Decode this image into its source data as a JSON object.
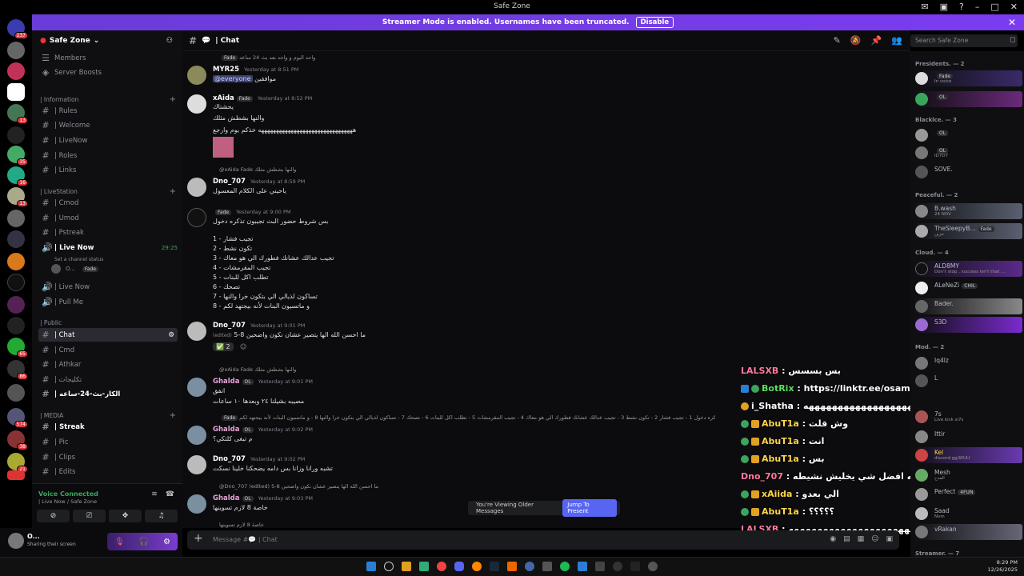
{
  "window": {
    "title": "Safe Zone"
  },
  "banner": {
    "text": "Streamer Mode is enabled. Usernames have been truncated.",
    "button": "Disable"
  },
  "server": {
    "name": "Safe Zone"
  },
  "sidebar": {
    "top_items": [
      "Members",
      "Server Boosts"
    ],
    "categories": [
      {
        "label": "| Information",
        "channels": [
          "| Rules",
          "| Welcome",
          "| LiveNow",
          "| Roles",
          "| Links"
        ]
      },
      {
        "label": "| LiveStation",
        "channels": [
          "| Cmod",
          "| Umod",
          "| Pstreak",
          "| Live Now",
          "| Live Now",
          "| Pull Me"
        ]
      },
      {
        "label": "| Public",
        "channels": [
          "| Chat",
          "| Cmd",
          "| Athkar",
          "| تكليجات",
          "| الكار-بث-24-ساعه"
        ]
      },
      {
        "label": "| MEDIA",
        "channels": [
          "| Streak",
          "| Pic",
          "| Clips",
          "| Edits"
        ]
      }
    ],
    "live_now_time": "29:25",
    "channel_status": "Set a channel status",
    "voice_user": "O...",
    "voice_tag": "Fade"
  },
  "voice": {
    "status": "Voice Connected",
    "location": "| Live Now / Safe Zone"
  },
  "user": {
    "name": "O...",
    "status": "Sharing their screen"
  },
  "chat": {
    "channel": "| Chat",
    "search_placeholder": "Search Safe Zone",
    "input_placeholder": "Message #💬 | Chat",
    "messages": [
      {
        "reply": "واحد اليوم و واحد بعد بث 24 ساعه",
        "tag": "Fade"
      },
      {
        "user": "MYR25",
        "time": "Yesterday at 8:51 PM",
        "mention": "@everyone",
        "text": "موافقين"
      },
      {
        "user": "xAida",
        "tag": "Fade",
        "time": "Yesterday at 8:52 PM",
        "lines": [
          "يحشتاك",
          "والنها بشطش مثلك",
          "ههههههههههههههههههههههههههههههههه خذكم يوم وارجع"
        ]
      },
      {
        "reply": "@xAida Fade والنها بشطش مثلك"
      },
      {
        "user": "Dno_707",
        "time": "Yesterday at 8:59 PM",
        "text": "ياحيني على الكلام المعسول"
      },
      {
        "tag": "Fade",
        "time": "Yesterday at 9:00 PM",
        "lines": [
          "بس شروط حضور البث تجيبون تذكره دخول",
          "1 - تجيب فشار",
          "2 - تكون نشط",
          "3 - تجيب عدالك عشانك فطورك الي هو معاك",
          "4 - تجيب المقرمشات",
          "5 - تطلب اكل للبنات",
          "6 - تصحك",
          "7 - تساكون لذيالي الي بتكون خرا والنها",
          "8 - و ماتسيون البنات لأنه بيجتهد لكم"
        ]
      },
      {
        "user": "Dno_707",
        "time": "Yesterday at 9:01 PM",
        "text": "ما احسن الله الها يتصير عشان نكون واضحين 8-5",
        "edited": "(edited)",
        "reaction": "2"
      },
      {
        "reply": "@xAida Fade والنها بشطش مثلك"
      },
      {
        "user": "Ghalda",
        "tag": "OL",
        "time": "Yesterday at 9:01 PM",
        "lines": [
          "اتفق",
          "مصيبه بشيلنا ٢٤ وبعدها ١٠ ساعات"
        ]
      },
      {
        "reply": "شروط حضور البث تجيبون تذكره دخول 1 - تجيب فشار 2 - تكون نشط 3 - تجيب عدالك عشانك فطورك الي هو معاك 4 - تجيب المقرمشات 5 - تطلب اكل للبنات 6 - تصحك 7 - تساكون لذيالي الي بتكون خرا والنها 8 - و ماتسيون البنات لأنه بيجتهد لكم",
        "tag": "Fade"
      },
      {
        "user": "Ghalda",
        "tag": "OL",
        "time": "Yesterday at 9:02 PM",
        "text": "م تبغى كلتكي؟"
      },
      {
        "user": "Dno_707",
        "time": "Yesterday at 9:02 PM",
        "text": "تشبه ورانا وزانا بس دامه يضحكنا خلينا نسكت"
      },
      {
        "reply": "@Dno_707 (edited) ما احسن الله الها يتصير عشان نكون واضحين 8-5"
      },
      {
        "user": "Ghalda",
        "tag": "OL",
        "time": "Yesterday at 9:03 PM",
        "text": "خاصة 8 لازم تسوينها"
      },
      {
        "reply": "خاصة 8 لازم تسوينها"
      }
    ],
    "jump": {
      "text": "You're Viewing Older Messages",
      "button": "Jump To Present"
    }
  },
  "overlay": [
    {
      "user": "LALSXB",
      "text": "بس بسسس"
    },
    {
      "user": "BotRix",
      "text": "https://linktr.ee/osamaaah | هنا تلقون كل حساباتي"
    },
    {
      "user": "i_Shatha",
      "text": "ههههههههههههههههههههههه"
    },
    {
      "user": "AbuT1a",
      "text": "وش قلت"
    },
    {
      "user": "AbuT1a",
      "text": "انت"
    },
    {
      "user": "AbuT1a",
      "text": "بس"
    },
    {
      "user": "Dno_707",
      "text": "الدمه الصبريه افضل شي يخليش نشيطه"
    },
    {
      "user": "xAiida",
      "text": "الي بعدو"
    },
    {
      "user": "AbuT1a",
      "text": "؟؟؟؟؟"
    },
    {
      "user": "LALSXB",
      "text": "ههههههههههههههههههههههههههههههه"
    }
  ],
  "members": {
    "groups": [
      {
        "label": "Presidents. — 2",
        "items": [
          {
            "name": "",
            "status": "In voice",
            "tag": "Fade"
          },
          {
            "name": "",
            "tag": "OL"
          }
        ]
      },
      {
        "label": "Blacklce. — 3",
        "items": [
          {
            "name": "",
            "tag": "OL"
          },
          {
            "name": "",
            "tag": "OL",
            "status": "ID7D7"
          },
          {
            "name": "SOVE."
          }
        ]
      },
      {
        "label": "Peaceful. — 2",
        "items": [
          {
            "name": "B.wash",
            "status": "24 NOV"
          },
          {
            "name": "TheSleepyB...",
            "tag": "Fade",
            "status": "حزين"
          }
        ]
      },
      {
        "label": "Cloud. — 4",
        "items": [
          {
            "name": "ALD8MY",
            "status": "Don't stop , success isn't that ..."
          },
          {
            "name": "ALeNeZi",
            "tag": "CHIL"
          },
          {
            "name": "Bader."
          },
          {
            "name": "S3D"
          }
        ]
      },
      {
        "label": "Mod. — 2",
        "items": [
          {
            "name": "Iq4lz"
          },
          {
            "name": "L"
          }
        ]
      },
      {
        "label": "",
        "items": [
          {
            "name": "7s",
            "status": "Live kick si7s"
          },
          {
            "name": "Ittir"
          },
          {
            "name": "Kel",
            "status": "discord.gg/WUU"
          },
          {
            "name": "Mesh",
            "status": "المدح"
          },
          {
            "name": "Perfect",
            "tag": "4FUN"
          },
          {
            "name": "Saad",
            "status": "Nvm"
          },
          {
            "name": "vRakan"
          }
        ]
      },
      {
        "label": "Streamer. — 7",
        "items": []
      }
    ]
  },
  "taskbar": {
    "time": "8:29 PM",
    "date": "12/26/2025"
  },
  "colors": {
    "accent": "#5865f2",
    "banner": "#7b3cf0"
  }
}
